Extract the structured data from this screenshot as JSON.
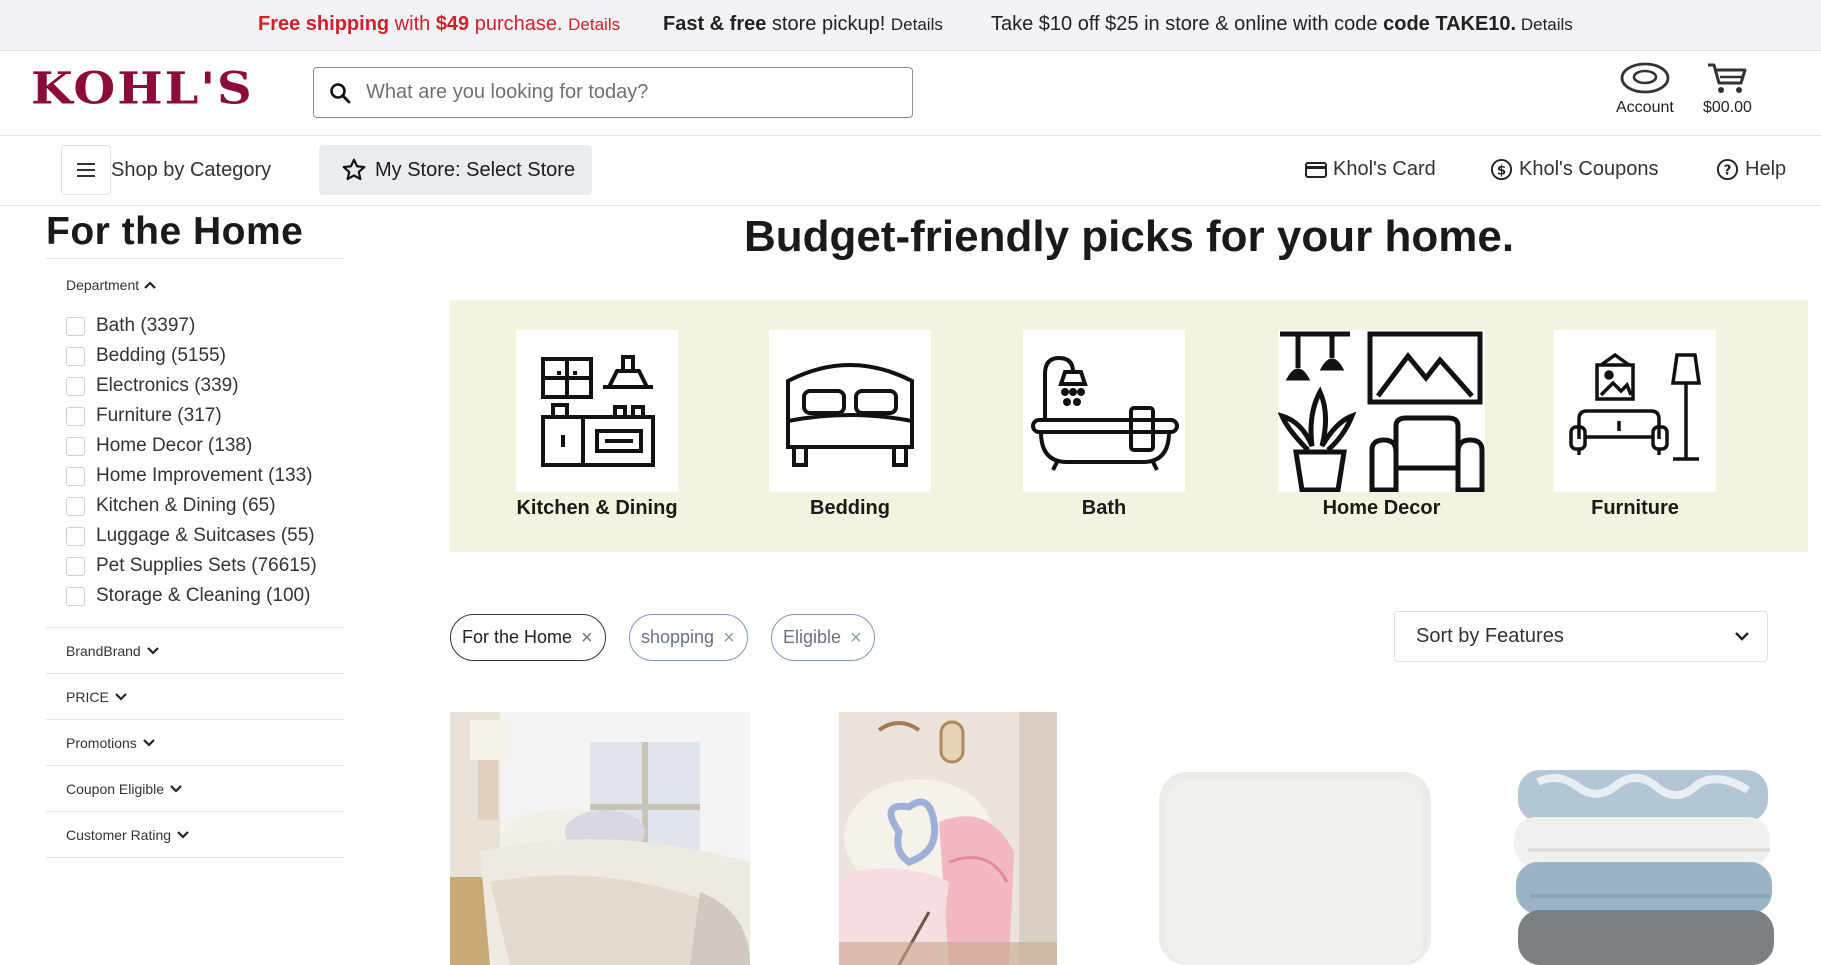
{
  "promo_bar": {
    "free_shipping": {
      "bold": "Free shipping",
      "text": " with ",
      "amount": "$49",
      "rest": " purchase. ",
      "details": "Details"
    },
    "pickup": {
      "bold": "Fast & free",
      "text": " store pickup! ",
      "details": "Details"
    },
    "coupon": {
      "text": "Take $10 off $25 in store & online with code ",
      "code": "code TAKE10.",
      "details": " Details"
    }
  },
  "header": {
    "logo": "KOHL'S",
    "search_placeholder": "What are you looking for today?",
    "account_label": "Account",
    "cart_amount": "$00.00"
  },
  "nav": {
    "shop_by_category": "Shop by Category",
    "my_store": "My Store: Select Store",
    "card": "Khol's Card",
    "coupons": "Khol's Coupons",
    "help": "Help"
  },
  "sidebar": {
    "title": "For the Home",
    "department_label": "Department",
    "departments": [
      {
        "label": "Bath (3397)"
      },
      {
        "label": "Bedding (5155)"
      },
      {
        "label": "Electronics (339)"
      },
      {
        "label": "Furniture (317)"
      },
      {
        "label": "Home Decor (138)"
      },
      {
        "label": "Home Improvement (133)"
      },
      {
        "label": "Kitchen & Dining (65)"
      },
      {
        "label": "Luggage & Suitcases (55)"
      },
      {
        "label": "Pet Supplies Sets (76615)"
      },
      {
        "label": "Storage & Cleaning (100)"
      }
    ],
    "filters": [
      "BrandBrand",
      "PRICE",
      "Promotions",
      "Coupon Eligible",
      "Customer Rating"
    ]
  },
  "main": {
    "headline": "Budget-friendly picks for your home.",
    "categories": [
      {
        "label": "Kitchen & Dining",
        "icon": "kitchen-icon"
      },
      {
        "label": "Bedding",
        "icon": "bed-icon"
      },
      {
        "label": "Bath",
        "icon": "bathtub-icon"
      },
      {
        "label": "Home Decor",
        "icon": "home-decor-icon"
      },
      {
        "label": "Furniture",
        "icon": "furniture-icon"
      }
    ],
    "chips": [
      "For the Home",
      "shopping",
      "Eligible"
    ],
    "chip_remove": "×",
    "sort_label": "Sort by Features"
  },
  "colors": {
    "brand": "#8a0c3a",
    "promo_red": "#d12028",
    "banner_bg": "#f3f3df"
  }
}
